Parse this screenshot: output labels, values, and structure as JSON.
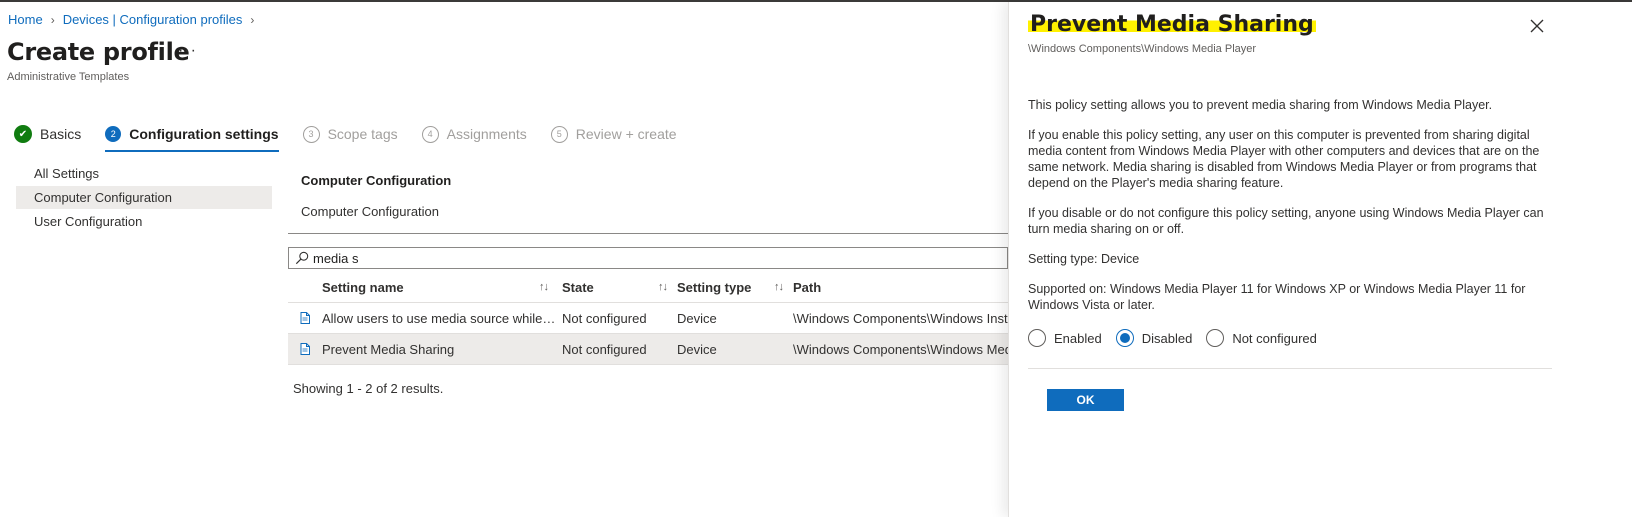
{
  "breadcrumb": {
    "home": "Home",
    "parent": "Devices | Configuration profiles"
  },
  "page": {
    "title": "Create profile",
    "more": "···",
    "subtitle": "Administrative Templates"
  },
  "wizard": {
    "steps": [
      {
        "number": "✔",
        "label": "Basics",
        "status": "done"
      },
      {
        "number": "2",
        "label": "Configuration settings",
        "status": "current"
      },
      {
        "number": "3",
        "label": "Scope tags",
        "status": "todo"
      },
      {
        "number": "4",
        "label": "Assignments",
        "status": "todo"
      },
      {
        "number": "5",
        "label": "Review + create",
        "status": "todo"
      }
    ]
  },
  "sidenav": {
    "items": [
      "All Settings",
      "Computer Configuration",
      "User Configuration"
    ],
    "selected": "Computer Configuration"
  },
  "section": {
    "title": "Computer Configuration",
    "subtitle": "Computer Configuration"
  },
  "search": {
    "value": "media s",
    "icon": "search-icon"
  },
  "table": {
    "columns": {
      "name": "Setting name",
      "state": "State",
      "type": "Setting type",
      "path": "Path",
      "sort_glyph": "↑↓"
    },
    "rows": [
      {
        "name": "Allow users to use media source while e...",
        "state": "Not configured",
        "type": "Device",
        "path": "\\Windows Components\\Windows Insta",
        "icon": "document-icon"
      },
      {
        "name": "Prevent Media Sharing",
        "state": "Not configured",
        "type": "Device",
        "path": "\\Windows Components\\Windows Medi",
        "icon": "document-icon"
      }
    ],
    "results": "Showing 1 - 2 of 2 results."
  },
  "panel": {
    "title": "Prevent Media Sharing",
    "path": "\\Windows Components\\Windows Media Player",
    "paragraphs": [
      "This policy setting allows you to prevent media sharing from Windows Media Player.",
      "If you enable this policy setting, any user on this computer is prevented from sharing digital media content from Windows Media Player with other computers and devices that are on the same network. Media sharing is disabled from Windows Media Player or from programs that depend on the Player's media sharing feature.",
      "If you disable or do not configure this policy setting, anyone using Windows Media Player can turn media sharing on or off.",
      "Setting type: Device",
      "Supported on: Windows Media Player 11 for Windows XP or Windows Media Player 11 for Windows Vista or later."
    ],
    "options": [
      "Enabled",
      "Disabled",
      "Not configured"
    ],
    "selected_option": "Disabled",
    "ok_label": "OK",
    "highlight_color": "#fff100"
  },
  "colors": {
    "accent": "#0f6cbd",
    "success": "#107c10",
    "selected_bg": "#edebe9"
  }
}
